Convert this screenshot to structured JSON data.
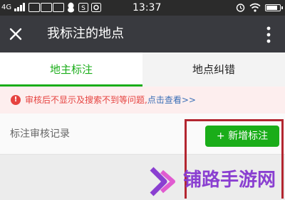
{
  "status_bar": {
    "network": "4G",
    "time": "13:37",
    "notification_icons": [
      "carrier-badge-1",
      "carrier-badge-2",
      "carrier-badge-3",
      "qq-icon",
      "sms-icon",
      "settings-box-icon"
    ],
    "battery_level": 0.85
  },
  "title_bar": {
    "title": "我标注的地点",
    "close_icon": "close-icon",
    "more_icon": "more-vertical-icon"
  },
  "tabs": [
    {
      "label": "地主标注",
      "active": true
    },
    {
      "label": "地点纠错",
      "active": false
    }
  ],
  "notice": {
    "icon": "exclamation-icon",
    "text": "审核后不显示及搜索不到等问题,",
    "link": "点击查看>>"
  },
  "records": {
    "label": "标注审核记录",
    "add_button": "+ 新增标注"
  },
  "watermark": {
    "text": "铺路手游网"
  },
  "colors": {
    "accent_green": "#1aad19",
    "header_bg": "#393a3f",
    "notice_red": "#e64340",
    "link_blue": "#3b6fb6",
    "highlight_red": "#b32630",
    "watermark_purple": "#8a3fd1"
  }
}
